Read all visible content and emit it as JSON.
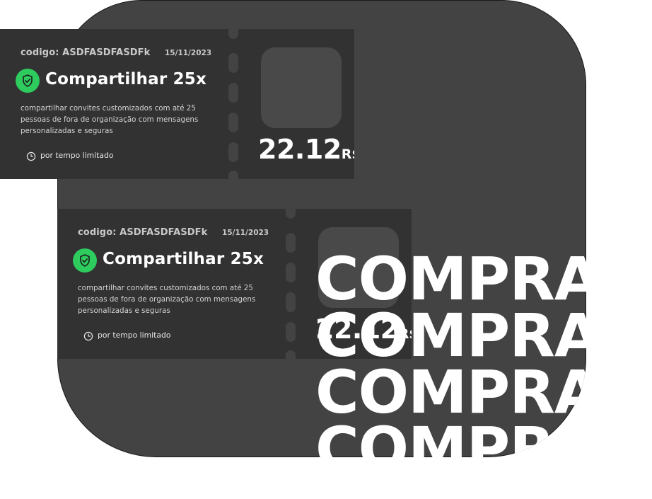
{
  "tickets": [
    {
      "code": "codigo: ASDFASDFASDFk",
      "date": "15/11/2023",
      "title": "Compartilhar 25x",
      "description": "compartilhar convites customizados com até 25 pessoas de fora de organização com mensagens personalizadas e seguras",
      "limited": "por tempo limitado",
      "price": "22.12",
      "currency": "R$",
      "icon": "shield-check-icon"
    },
    {
      "code": "codigo: ASDFASDFASDFk",
      "date": "15/11/2023",
      "title": "Compartilhar 25x",
      "description": "compartilhar convites customizados com até 25 pessoas de fora de organização com mensagens personalizadas e seguras",
      "limited": "por tempo limitado",
      "price": "22.12",
      "currency": "R$",
      "icon": "shield-check-icon"
    }
  ],
  "banner": [
    "COMPRA",
    "COMPRA",
    "COMPRA",
    "COMPRA"
  ],
  "colors": {
    "panel": "#434343",
    "ticket": "#323232",
    "accent": "#2ecc5f",
    "text": "#ffffff"
  }
}
